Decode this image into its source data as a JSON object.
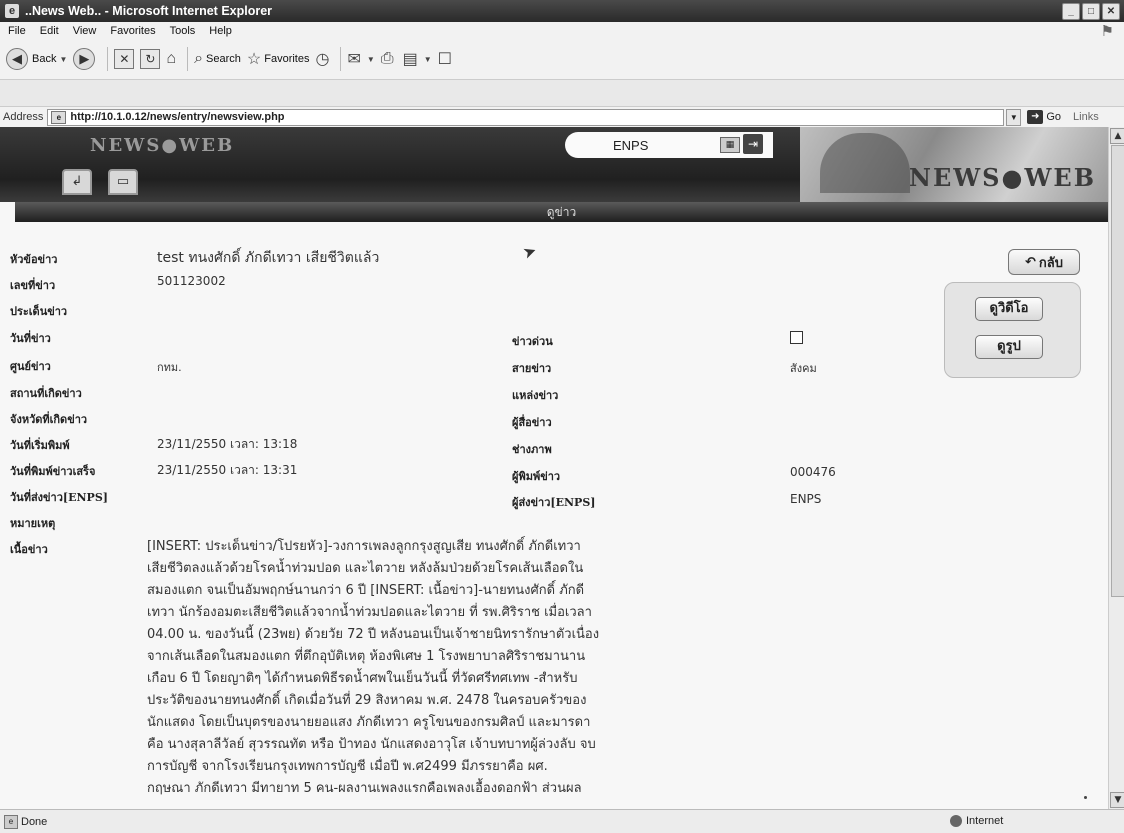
{
  "window": {
    "title": "..News Web.. - Microsoft Internet Explorer"
  },
  "menu": [
    "File",
    "Edit",
    "View",
    "Favorites",
    "Tools",
    "Help"
  ],
  "toolbar": {
    "back": "Back",
    "search": "Search",
    "favorites": "Favorites"
  },
  "address": {
    "label": "Address",
    "url": "http://10.1.0.12/news/entry/newsview.php",
    "go": "Go",
    "links": "Links"
  },
  "header": {
    "logo_small": "NEWS●WEB",
    "logo_big": "NEWS●WEB",
    "enps": "ENPS",
    "section_title": "ดูข่าว"
  },
  "buttons": {
    "back": "กลับ",
    "video": "ดูวิดีโอ",
    "photo": "ดูรูป"
  },
  "fields": {
    "headline_label": "หัวข้อข่าว",
    "headline": "test ทนงศักดิ์ ภักดีเทวา เสียชีวิตแล้ว",
    "id_label": "เลขที่ข่าว",
    "id": "501123002",
    "issue_label": "ประเด็นข่าว",
    "date_label": "วันที่ข่าว",
    "urgent_label": "ข่าวด่วน",
    "center_label": "ศูนย์ข่าว",
    "center": "กทม.",
    "line_label": "สายข่าว",
    "line": "สังคม",
    "place_label": "สถานที่เกิดข่าว",
    "source_label": "แหล่งข่าว",
    "province_label": "จังหวัดที่เกิดข่าว",
    "reporter_label": "ผู้สื่อข่าว",
    "start_label": "วันที่เริ่มพิมพ์",
    "start": "23/11/2550 เวลา: 13:18",
    "photographer_label": "ช่างภาพ",
    "finish_label": "วันที่พิมพ์ข่าวเสร็จ",
    "finish": "23/11/2550 เวลา: 13:31",
    "typist_label": "ผู้พิมพ์ข่าว",
    "typist": "000476",
    "sent_label": "วันที่ส่งข่าว[ENPS]",
    "sender_label": "ผู้ส่งข่าว[ENPS]",
    "sender": "ENPS",
    "remark_label": "หมายเหตุ",
    "body_label": "เนื้อข่าว"
  },
  "body": "[INSERT: ประเด็นข่าว/โปรยหัว]-วงการเพลงลูกกรุงสูญเสีย ทนงศักดิ์ ภักดีเทวา\nเสียชีวิตลงแล้วด้วยโรคน้ำท่วมปอด และไตวาย หลังล้มป่วยด้วยโรคเส้นเลือดใน\nสมองแตก จนเป็นอัมพฤกษ์นานกว่า 6 ปี [INSERT: เนื้อข่าว]-นายทนงศักดิ์ ภักดี\nเทวา นักร้องอมตะเสียชีวิตแล้วจากน้ำท่วมปอดและไตวาย ที่ รพ.ศิริราช เมื่อเวลา\n04.00 น. ของวันนี้ (23พย) ด้วยวัย 72 ปี หลังนอนเป็นเจ้าชายนิทรารักษาตัวเนื่อง\nจากเส้นเลือดในสมองแตก ที่ตึกอุบัติเหตุ ห้องพิเศษ 1 โรงพยาบาลศิริราชมานาน\nเกือบ 6 ปี โดยญาติๆ ได้กำหนดพิธีรดน้ำศพในเย็นวันนี้ ที่วัดศรีทศเทพ -สำหรับ\nประวัติของนายทนงศักดิ์ เกิดเมื่อวันที่ 29 สิงหาคม พ.ศ. 2478 ในครอบครัวของ\nนักแสดง โดยเป็นบุตรของนายยอแสง ภักดีเทวา ครูโขนของกรมศิลป์ และมารดา\nคือ นางสุลาลีวัลย์ สุวรรณทัต หรือ ป้าทอง นักแสดงอาวุโส เจ้าบทบาทผู้ล่วงลับ จบ\nการบัญชี จากโรงเรียนกรุงเทพการบัญชี เมื่อปี พ.ศ2499 มีภรรยาคือ ผศ.\nกฤษณา ภักดีเทวา มีทายาท 5 คน-ผลงานเพลงแรกคือเพลงเอื้องดอกฟ้า ส่วนผล",
  "status": {
    "left": "Done",
    "zone": "Internet"
  }
}
